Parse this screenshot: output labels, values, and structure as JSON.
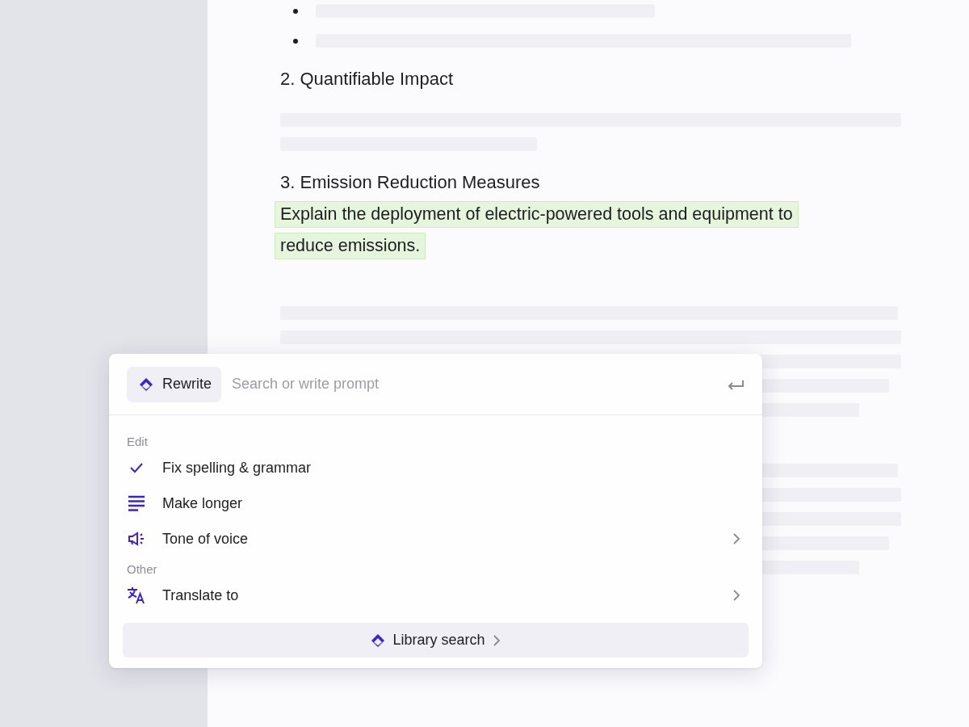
{
  "document": {
    "blocks": [
      {
        "kind": "bullets"
      },
      {
        "kind": "heading",
        "text": "2. Quantifiable Impact"
      },
      {
        "kind": "placeholder"
      },
      {
        "kind": "heading",
        "text": "3. Emission Reduction Measures"
      },
      {
        "kind": "paragraph",
        "lines": [
          "Explain the deployment of electric-powered tools and equipment to",
          "reduce emissions."
        ],
        "highlighted": true
      },
      {
        "kind": "placeholder"
      },
      {
        "kind": "placeholder"
      }
    ]
  },
  "assistant_menu": {
    "mode_button": "Rewrite",
    "prompt": {
      "placeholder": "Search or write prompt"
    },
    "groups": [
      {
        "label": "Edit",
        "items": [
          {
            "kind": "check",
            "label": "Fix spelling & grammar",
            "has_submenu": false
          },
          {
            "kind": "lines",
            "label": "Make longer",
            "has_submenu": false
          },
          {
            "kind": "megaphone",
            "label": "Tone of voice",
            "has_submenu": true
          }
        ]
      },
      {
        "label": "Other",
        "items": [
          {
            "kind": "translate",
            "label": "Translate to",
            "has_submenu": true
          }
        ]
      }
    ],
    "footer_button": "Library search"
  }
}
